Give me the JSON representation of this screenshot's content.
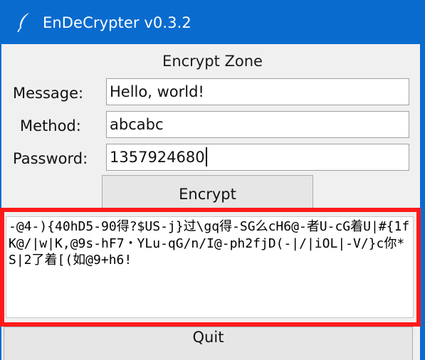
{
  "window": {
    "title": "EnDeCrypter v0.3.2",
    "icon": "feather-icon",
    "titlebar_color": "#0a6bcf"
  },
  "encrypt_zone": {
    "title": "Encrypt Zone",
    "message_label": "Message:",
    "message_value": "Hello, world!",
    "method_label": "Method:",
    "method_value": "abcabc",
    "password_label": "Password:",
    "password_value": "1357924680",
    "encrypt_button": "Encrypt",
    "output_text": "-@4-){40hD5-90得?$US-j}过\\gq得-SG么cH6@-者U-cG着U|#{1fK@/|w|K,@9s-hF7・YLu-qG/n/I@-ph2fjD(-|/|iOL|-V/}c你*S|2了着[(如@9+h6!",
    "highlight_color": "#ff1a1a"
  },
  "footer": {
    "quit_button": "Quit"
  }
}
